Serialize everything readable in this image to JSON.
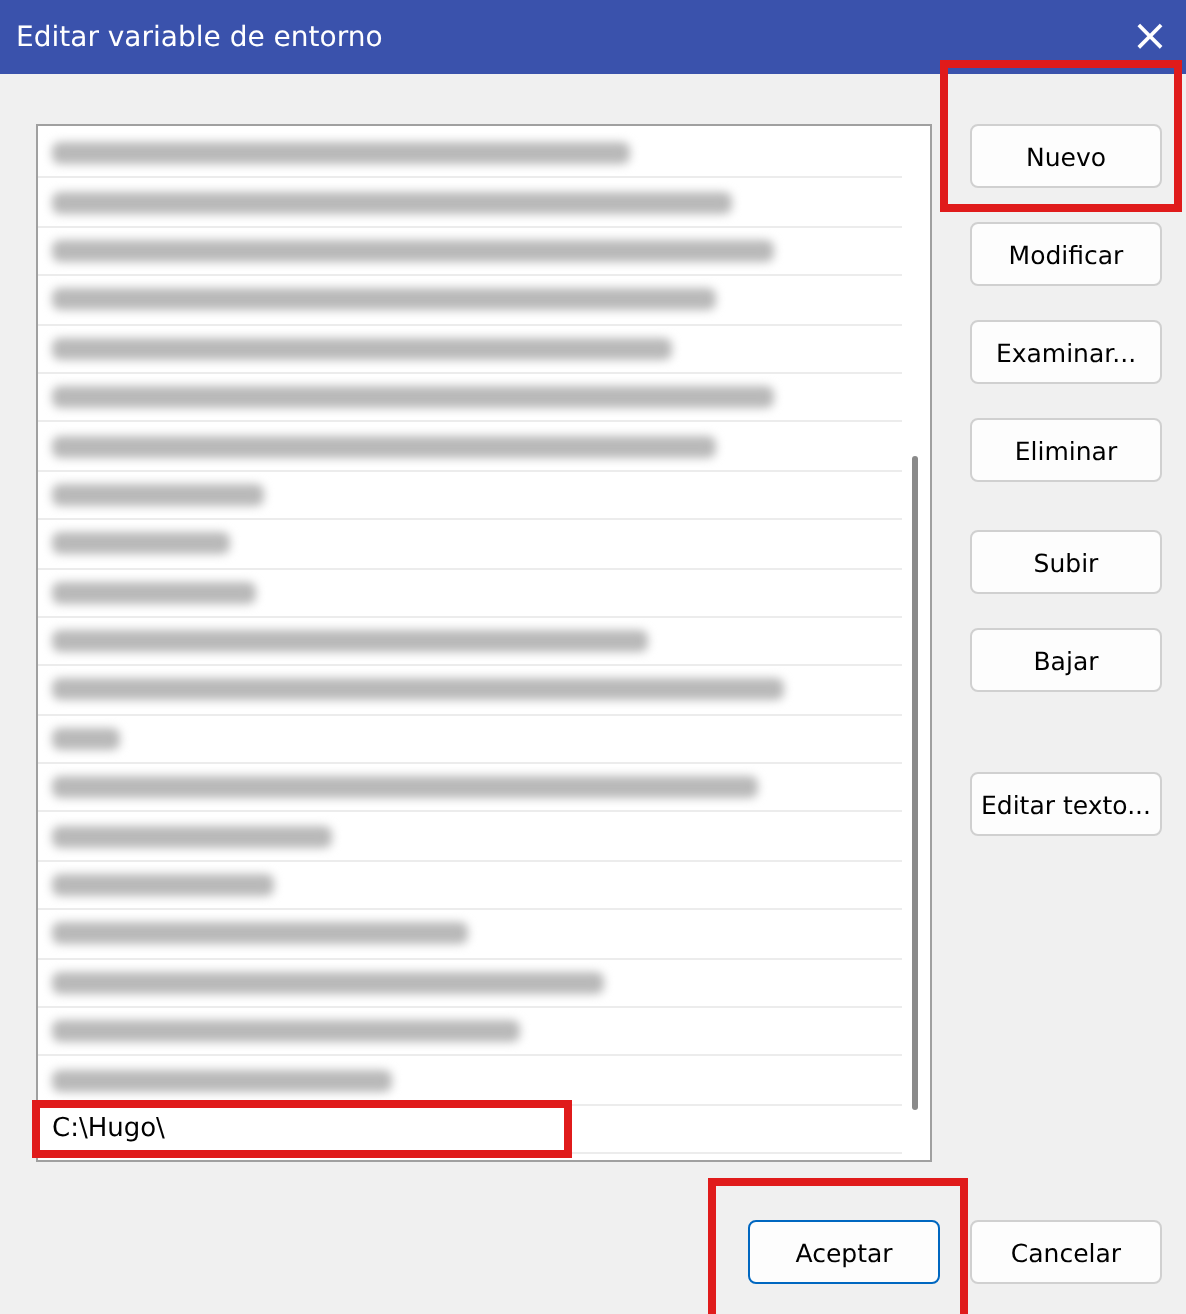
{
  "window": {
    "title": "Editar variable de entorno",
    "close": "×"
  },
  "list": {
    "items": [
      {
        "kind": "redacted",
        "selected": false,
        "highlighted": false
      },
      {
        "kind": "redacted",
        "selected": false,
        "highlighted": false
      },
      {
        "kind": "redacted",
        "selected": false,
        "highlighted": false
      },
      {
        "kind": "redacted",
        "selected": false,
        "highlighted": false
      },
      {
        "kind": "redacted",
        "selected": false,
        "highlighted": false
      },
      {
        "kind": "redacted",
        "selected": false,
        "highlighted": false
      },
      {
        "kind": "redacted",
        "selected": false,
        "highlighted": false
      },
      {
        "kind": "redacted",
        "selected": false,
        "highlighted": false
      },
      {
        "kind": "redacted",
        "selected": false,
        "highlighted": false
      },
      {
        "kind": "redacted",
        "selected": false,
        "highlighted": false
      },
      {
        "kind": "redacted",
        "selected": false,
        "highlighted": false
      },
      {
        "kind": "redacted",
        "selected": false,
        "highlighted": false
      },
      {
        "kind": "redacted",
        "selected": false,
        "highlighted": false
      },
      {
        "kind": "redacted",
        "selected": false,
        "highlighted": false
      },
      {
        "kind": "redacted",
        "selected": false,
        "highlighted": false
      },
      {
        "kind": "redacted",
        "selected": false,
        "highlighted": false
      },
      {
        "kind": "redacted",
        "selected": false,
        "highlighted": false
      },
      {
        "kind": "redacted",
        "selected": false,
        "highlighted": false
      },
      {
        "kind": "redacted",
        "selected": false,
        "highlighted": false
      },
      {
        "kind": "redacted",
        "selected": false,
        "highlighted": false
      },
      {
        "kind": "path",
        "text": "C:\\Hugo\\",
        "selected": false,
        "highlighted": true
      }
    ]
  },
  "button_groups": [
    [
      {
        "label": "Nuevo",
        "highlighted": true
      },
      {
        "label": "Modificar",
        "highlighted": false
      },
      {
        "label": "Examinar...",
        "highlighted": false
      },
      {
        "label": "Eliminar",
        "highlighted": false
      }
    ],
    [
      {
        "label": "Subir",
        "highlighted": false
      },
      {
        "label": "Bajar",
        "highlighted": false
      }
    ],
    [
      {
        "label": "Editar texto...",
        "highlighted": false
      }
    ]
  ],
  "footer_buttons": [
    {
      "label": "Aceptar",
      "default": true,
      "highlighted": true
    },
    {
      "label": "Cancelar",
      "default": false,
      "highlighted": false
    }
  ]
}
